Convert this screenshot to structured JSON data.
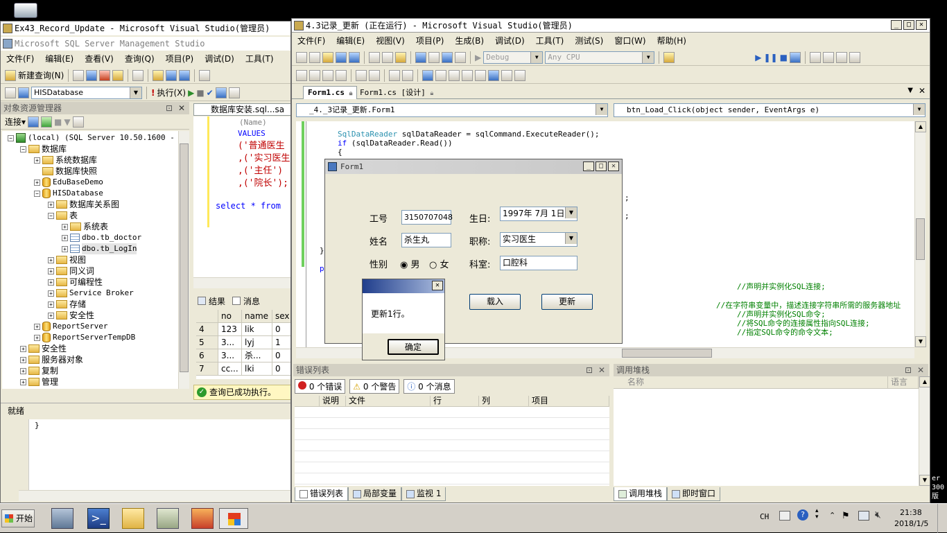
{
  "desktop": {
    "recycle_label": "",
    "right_edge_texts": [
      "er",
      "300",
      "版"
    ]
  },
  "ssms": {
    "tab_title": "Ex43_Record_Update - Microsoft Visual Studio(管理员)",
    "title": "Microsoft SQL Server Management Studio",
    "menu": [
      "文件(F)",
      "编辑(E)",
      "查看(V)",
      "查询(Q)",
      "项目(P)",
      "调试(D)",
      "工具(T)"
    ],
    "new_query": "新建查询(N)",
    "database_combo": "HISDatabase",
    "execute_label": "执行(X)",
    "explorer_title": "对象资源管理器",
    "connect_label": "连接▾",
    "tree": [
      "(local) (SQL Server 10.50.1600 - sa",
      "数据库",
      "系统数据库",
      "数据库快照",
      "EduBaseDemo",
      "HISDatabase",
      "数据库关系图",
      "表",
      "系统表",
      "dbo.tb_doctor",
      "dbo.tb_LogIn",
      "视图",
      "同义词",
      "可编程性",
      "Service Broker",
      "存储",
      "安全性",
      "ReportServer",
      "ReportServerTempDB",
      "安全性",
      "服务器对象",
      "复制",
      "管理"
    ],
    "query_tab": "数据库安装.sql...sa",
    "sql_lines": [
      "(Name)",
      "VALUES",
      "('普通医生",
      ",('实习医生",
      ",('主任')",
      ",('院长');",
      "select * from"
    ],
    "results_tab": "结果",
    "messages_tab": "消息",
    "grid_headers": [
      "no",
      "name",
      "sex"
    ],
    "grid_rows": [
      {
        "rn": "4",
        "no": "123",
        "name": "lik",
        "sex": "0"
      },
      {
        "rn": "5",
        "no": "3...",
        "name": "lyj",
        "sex": "1"
      },
      {
        "rn": "6",
        "no": "3...",
        "name": "杀...",
        "sex": "0"
      },
      {
        "rn": "7",
        "no": "cc...",
        "name": "lki",
        "sex": "0"
      }
    ],
    "query_status": "查询已成功执行。",
    "status_ready": "就绪",
    "bottom_code": "}"
  },
  "vs": {
    "title": "4.3记录_更新 (正在运行) - Microsoft Visual Studio(管理员)",
    "menu": [
      "文件(F)",
      "编辑(E)",
      "视图(V)",
      "项目(P)",
      "生成(B)",
      "调试(D)",
      "工具(T)",
      "测试(S)",
      "窗口(W)",
      "帮助(H)"
    ],
    "config_combo": "Debug",
    "platform_combo": "Any CPU",
    "doc_tabs": [
      "Form1.cs",
      "Form1.cs [设计]"
    ],
    "class_combo": "_4._3记录_更新.Form1",
    "method_combo": "btn_Load_Click(object sender, EventArgs e)",
    "code": {
      "line1_type": "SqlDataReader",
      "line1_rest": " sqlDataReader = sqlCommand.ExecuteReader();",
      "line2_kw": "if",
      "line2_rest": " (sqlDataReader.Read())",
      "line3": "{",
      "semi1": ";",
      "semi2": ";",
      "brace_close": "}",
      "p_char": "p",
      "cm1": "//声明并实例化SQL连接;",
      "cm2": "//在字符串变量中，描述连接字符串所需的服务器地址",
      "cm3": "//声明并实例化SQL命令;",
      "cm4": "//将SQL命令的连接属性指向SQL连接;",
      "cm5": "//指定SQL命令的命令文本;"
    },
    "error_list": {
      "title": "错误列表",
      "errors": "0 个错误",
      "warnings": "0 个警告",
      "messages": "0 个消息",
      "columns": [
        "说明",
        "文件",
        "行",
        "列",
        "项目"
      ]
    },
    "bottom_tabs_left": [
      "错误列表",
      "局部变量",
      "监视 1"
    ],
    "call_stack": {
      "title": "调用堆栈",
      "col_name": "名称",
      "col_lang": "语言"
    },
    "bottom_tabs_right": [
      "调用堆栈",
      "即时窗口"
    ]
  },
  "form1": {
    "title": "Form1",
    "labels": {
      "no": "工号",
      "name": "姓名",
      "sex": "性别",
      "birth": "生日:",
      "title": "职称:",
      "dept": "科室:"
    },
    "values": {
      "no": "3150707048",
      "name": "杀生丸",
      "birth": "1997年 7月 1日",
      "title": "实习医生",
      "dept": "口腔科"
    },
    "sex_options": [
      "男",
      "女"
    ],
    "sex_selected": "男",
    "load_button": "载入",
    "update_button": "更新"
  },
  "msgbox": {
    "text": "更新1行。",
    "ok": "确定"
  },
  "taskbar": {
    "start": "开始",
    "ime": "CH",
    "time": "21:38",
    "date": "2018/1/5"
  }
}
